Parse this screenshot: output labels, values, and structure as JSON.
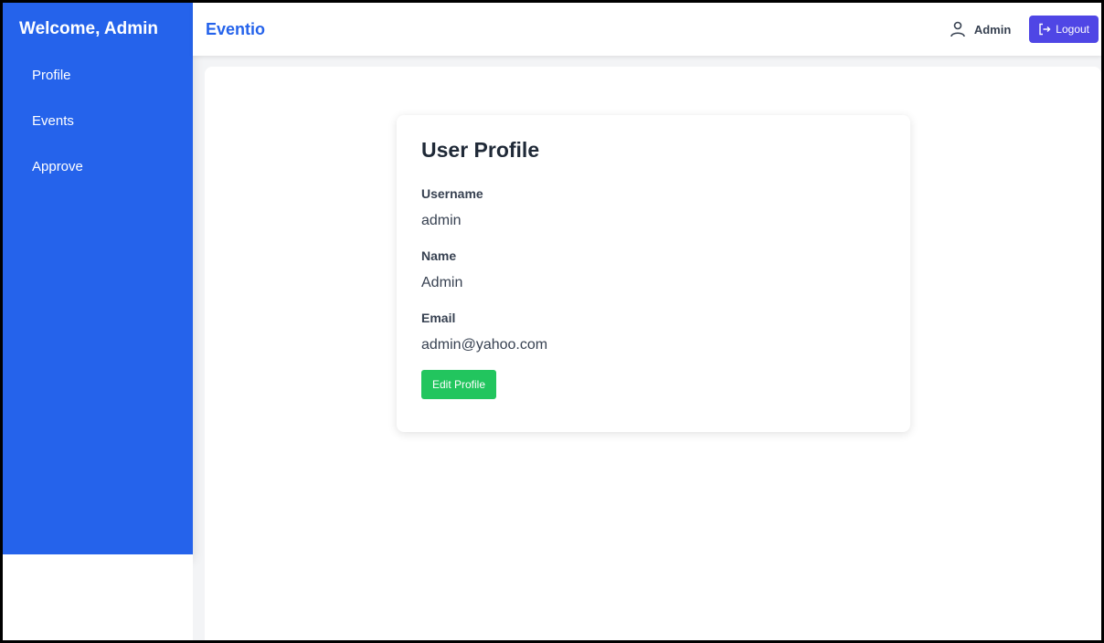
{
  "sidebar": {
    "title": "Welcome, Admin",
    "items": [
      {
        "label": "Profile"
      },
      {
        "label": "Events"
      },
      {
        "label": "Approve"
      }
    ]
  },
  "header": {
    "brand": "Eventio",
    "user_name": "Admin",
    "logout_label": "Logout",
    "icons": {
      "user": "user-icon",
      "logout": "logout-icon"
    }
  },
  "profile": {
    "title": "User Profile",
    "fields": [
      {
        "label": "Username",
        "value": "admin"
      },
      {
        "label": "Name",
        "value": "Admin"
      },
      {
        "label": "Email",
        "value": "admin@yahoo.com"
      }
    ],
    "edit_label": "Edit Profile"
  },
  "colors": {
    "sidebar": "#2563eb",
    "brand": "#2563eb",
    "logout": "#4f46e5",
    "edit": "#22c55e"
  }
}
